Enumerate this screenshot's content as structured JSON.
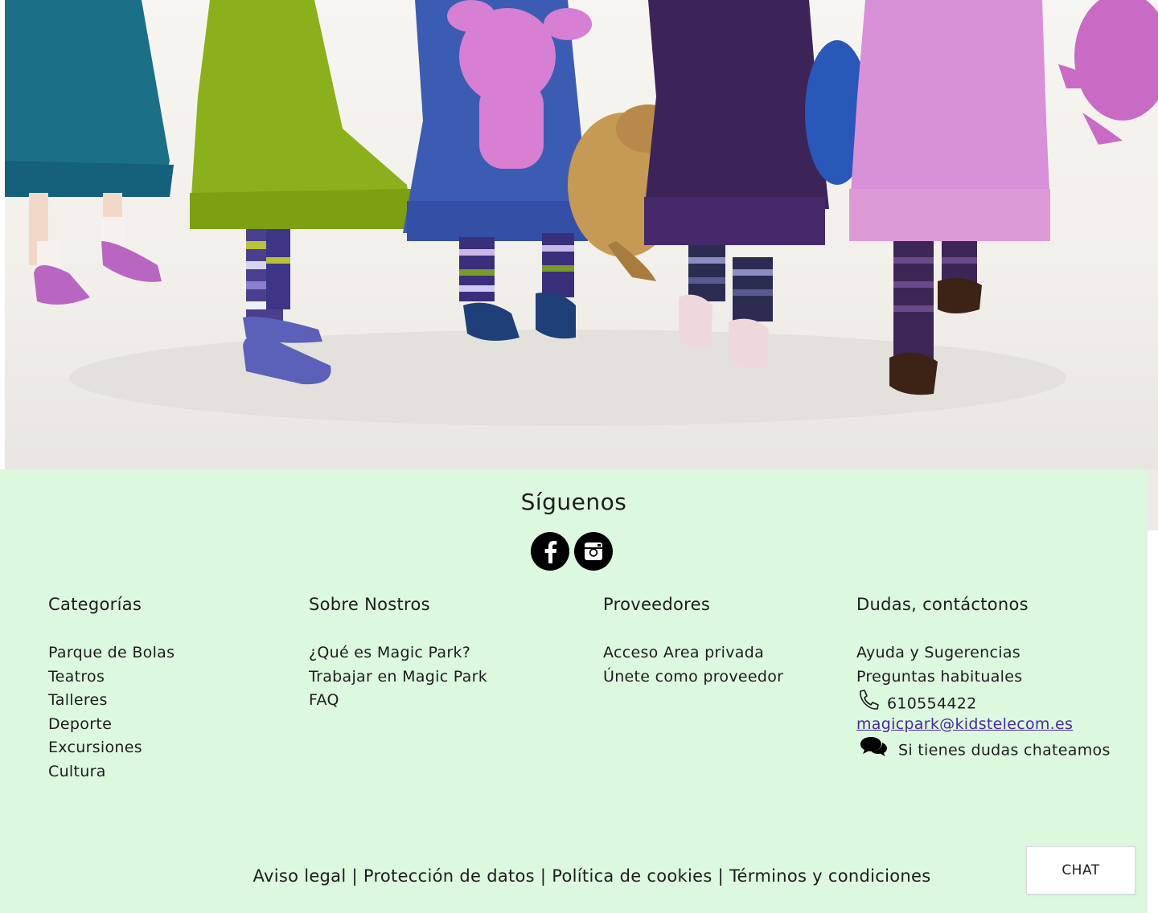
{
  "footer": {
    "follow_title": "Síguenos",
    "social": [
      {
        "name": "facebook",
        "icon": "facebook-icon"
      },
      {
        "name": "instagram",
        "icon": "instagram-icon"
      }
    ],
    "categories": {
      "title": "Categorías",
      "items": [
        "Parque de Bolas",
        "Teatros",
        "Talleres",
        "Deporte",
        "Excursiones",
        "Cultura"
      ]
    },
    "about": {
      "title": "Sobre Nostros",
      "items": [
        "¿Qué es Magic Park?",
        "Trabajar en Magic Park",
        "FAQ"
      ]
    },
    "providers": {
      "title": "Proveedores",
      "items": [
        "Acceso Area privada",
        "Únete como proveedor"
      ]
    },
    "contact": {
      "title": "Dudas, contáctonos",
      "help": "Ayuda y Sugerencias",
      "faq": "Preguntas habituales",
      "phone": "610554422",
      "email": "magicpark@kidstelecom.es",
      "chat_text": "Si tienes dudas chateamos"
    },
    "legal": {
      "aviso": "Aviso legal",
      "proteccion": "Protección de datos",
      "cookies": "Política de cookies",
      "terminos": "Términos y condiciones",
      "separator": "|"
    }
  },
  "chat_button": "CHAT",
  "colors": {
    "footer_bg": "#dcf8df",
    "link": "#4b2aa0"
  }
}
